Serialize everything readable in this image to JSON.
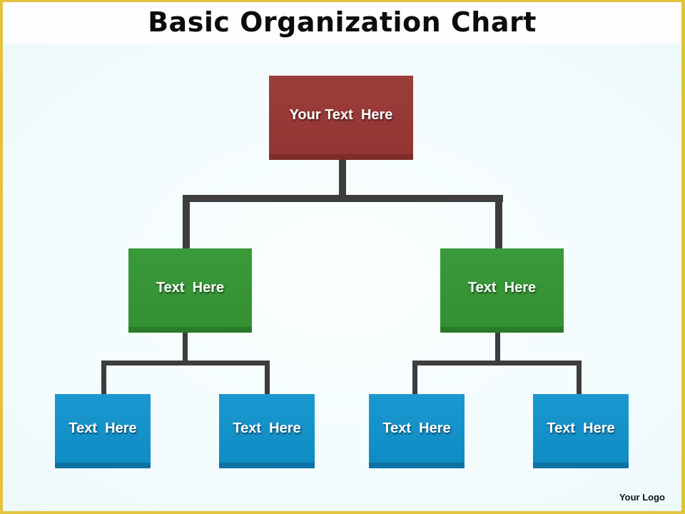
{
  "title": "Basic Organization Chart",
  "logo_text": "Your Logo",
  "colors": {
    "border": "#e3c23c",
    "root": "#963733",
    "level2": "#359435",
    "level3": "#1592c9",
    "connector": "#3d3d3d"
  },
  "nodes": {
    "root": {
      "label": "Your Text  Here"
    },
    "level2": [
      {
        "label": "Text  Here"
      },
      {
        "label": "Text  Here"
      }
    ],
    "level3": [
      {
        "label": "Text  Here"
      },
      {
        "label": "Text  Here"
      },
      {
        "label": "Text  Here"
      },
      {
        "label": "Text  Here"
      }
    ]
  }
}
